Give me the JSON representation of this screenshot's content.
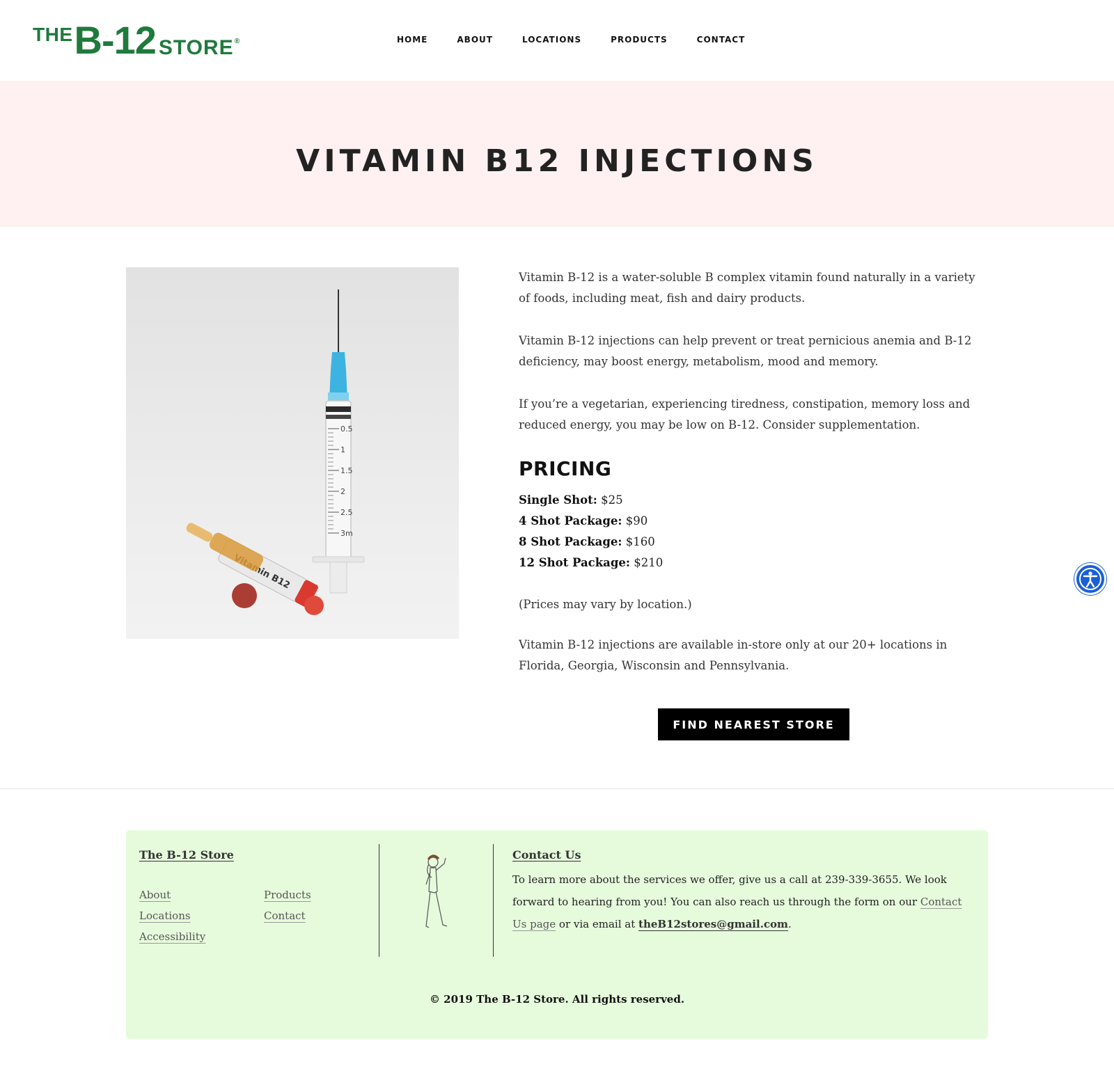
{
  "logo": {
    "the": "THE",
    "b12": "B-12",
    "store": "STORE",
    "reg": "®"
  },
  "nav": [
    "HOME",
    "ABOUT",
    "LOCATIONS",
    "PRODUCTS",
    "CONTACT"
  ],
  "hero": {
    "title": "VITAMIN B12 INJECTIONS"
  },
  "photo": {
    "label": "Vitamin B12",
    "scale": [
      "0.5",
      "1",
      "1.5",
      "2",
      "2.5",
      "3m"
    ]
  },
  "content": {
    "para1": "Vitamin B-12 is a water-soluble B complex vitamin found naturally in a variety of foods, including meat, fish and dairy products.",
    "para2": "Vitamin B-12 injections can help prevent or treat pernicious anemia and B-12 deficiency, may boost energy, metabolism, mood and memory.",
    "para3": "If you’re a vegetarian, experiencing tiredness, constipation, memory loss and reduced energy, you may be low on B-12. Consider supplementation.",
    "pricing_heading": "PRICING",
    "prices": [
      {
        "label": "Single Shot:",
        "value": " $25"
      },
      {
        "label": "4 Shot Package:",
        "value": " $90"
      },
      {
        "label": "8 Shot Package:",
        "value": " $160"
      },
      {
        "label": "12 Shot Package:",
        "value": " $210"
      }
    ],
    "note": "(Prices may vary by location.)",
    "availability": "Vitamin B-12 injections are available in-store only at our 20+ locations in Florida, Georgia, Wisconsin and Pennsylvania.",
    "cta": "FIND NEAREST STORE"
  },
  "footer": {
    "store_title": "The B-12 Store",
    "links": {
      "about": "About",
      "locations": "Locations",
      "accessibility": "Accessibility",
      "products": "Products",
      "contact": "Contact"
    },
    "contact_title": "Contact Us",
    "contact_text_1": "To learn more about the services we offer, give us a call at 239-339-3655. We look forward to hearing from you! You can also reach us through the form on our ",
    "contact_link": "Contact Us page",
    "contact_text_2": " or via email at ",
    "email": "theB12stores@gmail.com",
    "contact_text_3": ".",
    "copyright": "© 2019 The B-12 Store. All rights reserved."
  },
  "colors": {
    "brand_green": "#1f7a3c",
    "hero_bg": "#fff1f1",
    "footer_bg": "#e6fbdc",
    "accessibility_blue": "#1a5fd6"
  },
  "icons": {
    "accessibility": "accessibility-icon"
  }
}
